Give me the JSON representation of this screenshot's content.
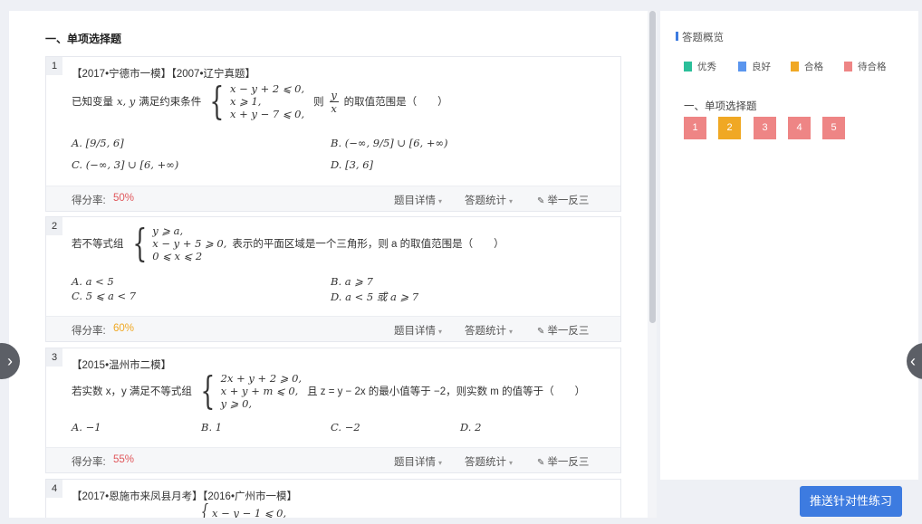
{
  "section": {
    "title": "一、单项选择题"
  },
  "questions": [
    {
      "num": "1",
      "source": "【2017•宁德市一模】【2007•辽宁真题】",
      "stem_pre": "已知变量",
      "stem_vars": "x, y",
      "stem_mid": "满足约束条件",
      "system": [
        "x − y + 2 ⩽ 0,",
        "x ⩾ 1,",
        "x + y − 7 ⩽ 0,"
      ],
      "stem_then": "则",
      "frac_num": "y",
      "frac_den": "x",
      "stem_post": "的取值范围是（　　）",
      "options": {
        "A": "A.  [9/5, 6]",
        "B": "B.  (−∞, 9/5] ∪ [6, +∞)",
        "C": "C.  (−∞, 3] ∪ [6, +∞)",
        "D": "D.  [3, 6]"
      },
      "score_label": "得分率:",
      "score": "50%",
      "score_color": "#e0575b"
    },
    {
      "num": "2",
      "stem_pre": "若不等式组",
      "system": [
        "y ⩾ a,",
        "x − y + 5 ⩾ 0,",
        "0 ⩽ x ⩽ 2"
      ],
      "stem_post": "表示的平面区域是一个三角形，则 a 的取值范围是（　　）",
      "options": {
        "A": "A.  a < 5",
        "B": "B.  a ⩾ 7",
        "C": "C.  5 ⩽ a < 7",
        "D": "D.  a < 5 或 a ⩾ 7"
      },
      "score_label": "得分率:",
      "score": "60%",
      "score_color": "#f0a824"
    },
    {
      "num": "3",
      "source": "【2015•温州市二模】",
      "stem_pre": "若实数 x，y 满足不等式组",
      "system": [
        "2x + y + 2 ⩾ 0,",
        "x + y + m ⩽ 0,",
        "y ⩾ 0,"
      ],
      "stem_post": "且 z = y − 2x 的最小值等于 −2，则实数 m 的值等于（　　）",
      "options": {
        "A": "A.  −1",
        "B": "B.  1",
        "C": "C.  −2",
        "D": "D.  2"
      },
      "score_label": "得分率:",
      "score": "55%",
      "score_color": "#e0575b"
    },
    {
      "num": "4",
      "source": "【2017•恩施市来凤县月考】【2016•广州市一模】",
      "system_first": "x − y − 1 ⩽ 0,"
    }
  ],
  "footer": {
    "detail": "题目详情",
    "stats": "答题统计",
    "similar": "举一反三"
  },
  "sidebar": {
    "title": "答题概览",
    "legend": [
      {
        "label": "优秀",
        "color": "#2bbf9a"
      },
      {
        "label": "良好",
        "color": "#5a95ee"
      },
      {
        "label": "合格",
        "color": "#f0a824"
      },
      {
        "label": "待合格",
        "color": "#ee8585"
      }
    ],
    "section": "一、单项选择题",
    "boxes": [
      {
        "n": "1",
        "color": "#ee8585"
      },
      {
        "n": "2",
        "color": "#f0a824"
      },
      {
        "n": "3",
        "color": "#ee8585"
      },
      {
        "n": "4",
        "color": "#ee8585"
      },
      {
        "n": "5",
        "color": "#ee8585"
      }
    ]
  },
  "push_button": "推送针对性练习",
  "icons": {
    "nav_left": "chevron-right-icon",
    "nav_right": "chevron-left-icon",
    "similar": "pen-icon"
  }
}
